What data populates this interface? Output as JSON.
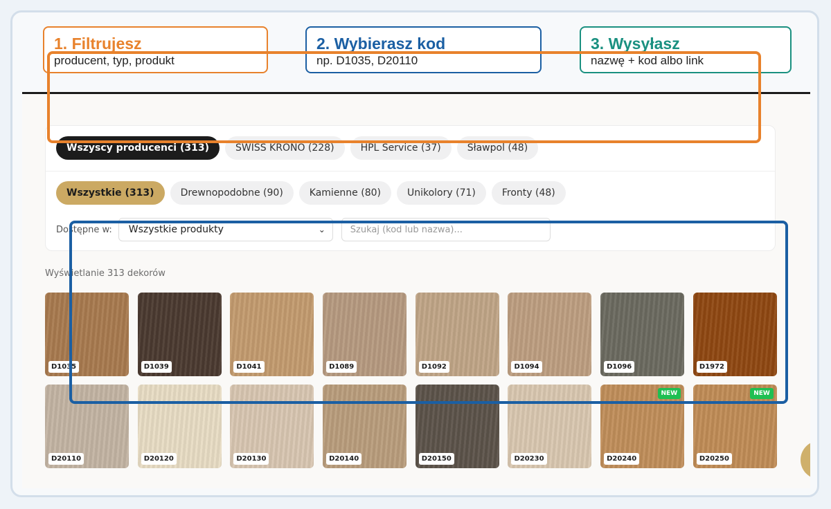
{
  "steps": [
    {
      "title": "1. Filtrujesz",
      "subtitle": "producent, typ, produkt",
      "color": "#e8822c"
    },
    {
      "title": "2. Wybierasz kod",
      "subtitle": "np. D1035, D20110",
      "color": "#1b5fa3"
    },
    {
      "title": "3. Wysyłasz",
      "subtitle": "nazwę + kod albo link",
      "color": "#1a9080"
    }
  ],
  "filters": {
    "producers": [
      "Wszyscy producenci (313)",
      "SWISS KRONO (228)",
      "HPL Service (37)",
      "Sławpol (48)"
    ],
    "producers_active": 0,
    "types": [
      "Wszystkie (313)",
      "Drewnopodobne (90)",
      "Kamienne (80)",
      "Unikolory (71)",
      "Fronty (48)"
    ],
    "types_active": 0,
    "available_label": "Dostępne w:",
    "available_value": "Wszystkie produkty",
    "search_placeholder": "Szukaj (kod lub nazwa)..."
  },
  "results": {
    "count_text": "Wyświetlanie 313 dekorów",
    "new_badge": "NEW",
    "decors": [
      {
        "code": "D1035",
        "color": "#a87a4f",
        "is_new": false
      },
      {
        "code": "D1039",
        "color": "#4b3a30",
        "is_new": false
      },
      {
        "code": "D1041",
        "color": "#c39b6f",
        "is_new": false
      },
      {
        "code": "D1089",
        "color": "#b69a80",
        "is_new": false
      },
      {
        "code": "D1092",
        "color": "#c0a587",
        "is_new": false
      },
      {
        "code": "D1094",
        "color": "#bd9e81",
        "is_new": false
      },
      {
        "code": "D1096",
        "color": "#6b6a60",
        "is_new": false
      },
      {
        "code": "D1972",
        "color": "#8f4812",
        "is_new": false
      },
      {
        "code": "D20110",
        "color": "#c3b4a3",
        "is_new": false
      },
      {
        "code": "D20120",
        "color": "#e8dcc4",
        "is_new": false
      },
      {
        "code": "D20130",
        "color": "#d8c6b1",
        "is_new": false
      },
      {
        "code": "D20140",
        "color": "#b99d7c",
        "is_new": false
      },
      {
        "code": "D20150",
        "color": "#5c534a",
        "is_new": false
      },
      {
        "code": "D20230",
        "color": "#d9c7b0",
        "is_new": false
      },
      {
        "code": "D20240",
        "color": "#c08e5a",
        "is_new": true
      },
      {
        "code": "D20250",
        "color": "#c08c56",
        "is_new": true
      }
    ]
  }
}
